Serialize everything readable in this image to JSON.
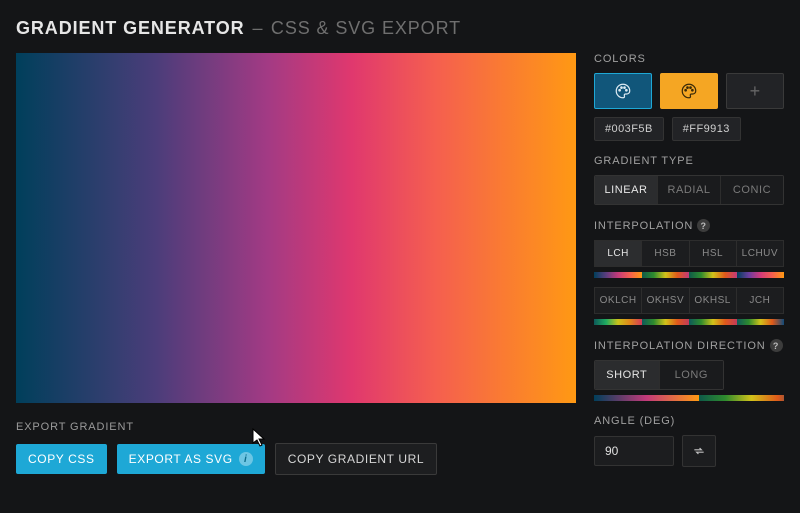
{
  "title": {
    "main": "GRADIENT GENERATOR",
    "sep": "–",
    "sub": "CSS & SVG EXPORT"
  },
  "export": {
    "heading": "EXPORT GRADIENT",
    "copy_css": "COPY CSS",
    "export_svg": "EXPORT AS SVG",
    "copy_url": "COPY GRADIENT URL"
  },
  "colors": {
    "heading": "COLORS",
    "hex": [
      "#003F5B",
      "#FF9913"
    ]
  },
  "gradient_type": {
    "heading": "GRADIENT TYPE",
    "options": [
      "LINEAR",
      "RADIAL",
      "CONIC"
    ],
    "active": "LINEAR"
  },
  "interpolation": {
    "heading": "INTERPOLATION",
    "row1": [
      "LCH",
      "HSB",
      "HSL",
      "LCHUV"
    ],
    "row2": [
      "OKLCH",
      "OKHSV",
      "OKHSL",
      "JCH"
    ],
    "active": "LCH"
  },
  "direction": {
    "heading": "INTERPOLATION DIRECTION",
    "options": [
      "SHORT",
      "LONG"
    ],
    "active": "SHORT"
  },
  "angle": {
    "heading": "ANGLE (DEG)",
    "value": "90"
  }
}
